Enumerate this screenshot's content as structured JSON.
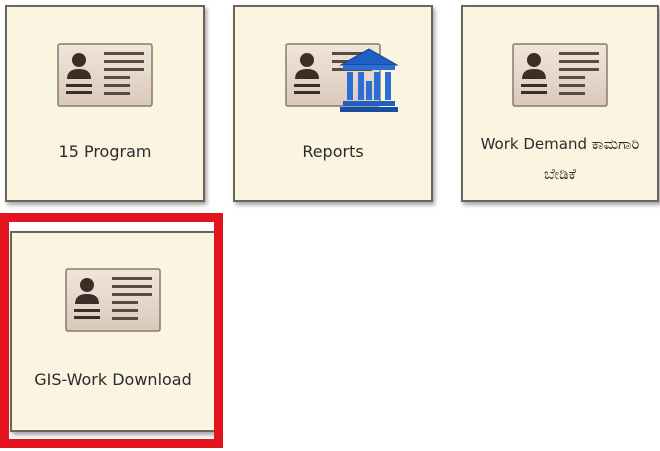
{
  "tiles": [
    {
      "label": "15 Program",
      "icon": "id-card-icon"
    },
    {
      "label": "Reports",
      "icon": "id-card-icon",
      "overlay_icon": "bank-building-icon"
    },
    {
      "label": "Work Demand ಕಾಮಗಾರಿ ಬೇಡಿಕೆ",
      "icon": "id-card-icon"
    },
    {
      "label": "GIS-Work Download",
      "icon": "id-card-icon",
      "highlighted": true
    }
  ],
  "colors": {
    "tile_background": "#fbf4e1",
    "tile_border": "#6b6458",
    "highlight": "#e3141f",
    "bank_icon": "#1f5fc4"
  }
}
